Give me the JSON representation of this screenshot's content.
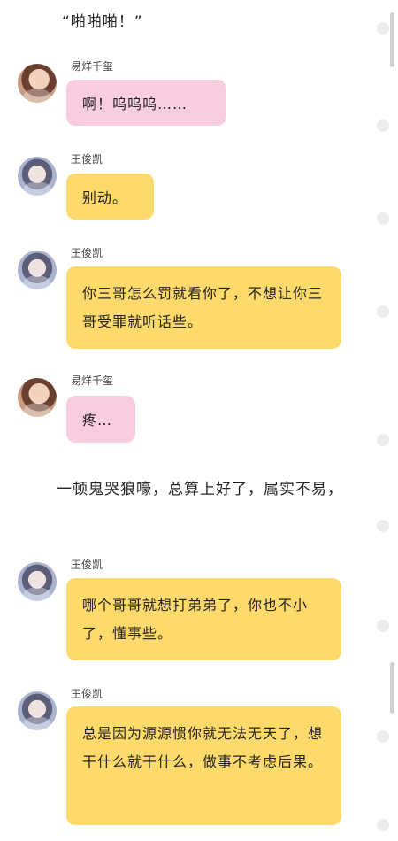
{
  "narration": {
    "line1": "“啪啪啪！”",
    "line2": "一顿鬼哭狼嚎，总算上好了，属实不易，"
  },
  "messages": [
    {
      "sender": "易烊千玺",
      "text": "啊！呜呜呜……",
      "color": "#f8cde0"
    },
    {
      "sender": "王俊凯",
      "text": "别动。",
      "color": "#fed96c"
    },
    {
      "sender": "王俊凯",
      "text": "你三哥怎么罚就看你了，不想让你三哥受罪就听话些。",
      "color": "#fed96c"
    },
    {
      "sender": "易烊千玺",
      "text": "疼…",
      "color": "#f8cde0"
    },
    {
      "sender": "王俊凯",
      "text": "哪个哥哥就想打弟弟了，你也不小了，懂事些。",
      "color": "#fed96c"
    },
    {
      "sender": "王俊凯",
      "text": "总是因为源源惯你就无法无天了，想干什么就干什么，做事不考虑后果。",
      "color": "#fed96c"
    }
  ]
}
